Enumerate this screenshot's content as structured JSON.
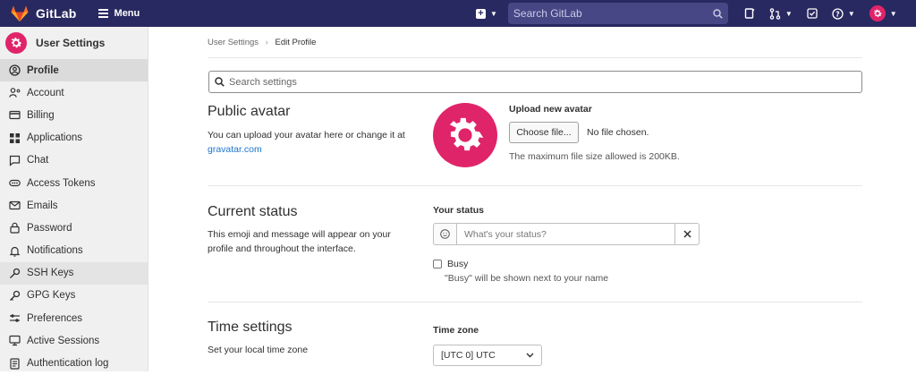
{
  "nav": {
    "brand": "GitLab",
    "menu_label": "Menu",
    "search_placeholder": "Search GitLab"
  },
  "sidebar": {
    "title": "User Settings",
    "items": [
      {
        "label": "Profile",
        "icon": "profile-icon"
      },
      {
        "label": "Account",
        "icon": "account-icon"
      },
      {
        "label": "Billing",
        "icon": "billing-icon"
      },
      {
        "label": "Applications",
        "icon": "applications-icon"
      },
      {
        "label": "Chat",
        "icon": "chat-icon"
      },
      {
        "label": "Access Tokens",
        "icon": "token-icon"
      },
      {
        "label": "Emails",
        "icon": "mail-icon"
      },
      {
        "label": "Password",
        "icon": "lock-icon"
      },
      {
        "label": "Notifications",
        "icon": "bell-icon"
      },
      {
        "label": "SSH Keys",
        "icon": "key-icon"
      },
      {
        "label": "GPG Keys",
        "icon": "key-icon"
      },
      {
        "label": "Preferences",
        "icon": "preferences-icon"
      },
      {
        "label": "Active Sessions",
        "icon": "monitor-icon"
      },
      {
        "label": "Authentication log",
        "icon": "log-icon"
      }
    ]
  },
  "breadcrumb": {
    "parent": "User Settings",
    "current": "Edit Profile"
  },
  "search_settings": {
    "placeholder": "Search settings"
  },
  "avatar_section": {
    "title": "Public avatar",
    "desc": "You can upload your avatar here or change it at",
    "link": "gravatar.com",
    "upload_label": "Upload new avatar",
    "choose_button": "Choose file...",
    "no_file": "No file chosen.",
    "max_size_note": "The maximum file size allowed is 200KB."
  },
  "status_section": {
    "title": "Current status",
    "desc": "This emoji and message will appear on your profile and throughout the interface.",
    "your_status_label": "Your status",
    "status_placeholder": "What's your status?",
    "busy_label": "Busy",
    "busy_note": "\"Busy\" will be shown next to your name"
  },
  "time_section": {
    "title": "Time settings",
    "desc": "Set your local time zone",
    "timezone_label": "Time zone",
    "timezone_value": "[UTC 0] UTC"
  },
  "colors": {
    "navbar": "#292961",
    "avatar_pink": "#e0246a",
    "link": "#1f75cb"
  }
}
